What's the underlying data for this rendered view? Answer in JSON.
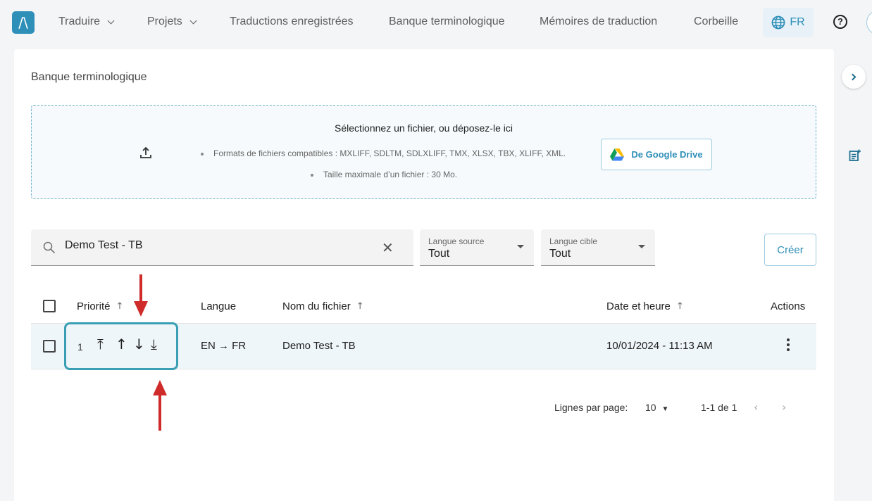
{
  "nav": {
    "logo": "/\\",
    "items": [
      "Traduire",
      "Projets",
      "Traductions enregistrées",
      "Banque terminologique",
      "Mémoires de traduction",
      "Corbeille"
    ],
    "language": "FR",
    "help": "?"
  },
  "page": {
    "title": "Banque terminologique"
  },
  "dropzone": {
    "title": "Sélectionnez un fichier, ou déposez-le ici",
    "formats": "Formats de fichiers compatibles : MXLIFF, SDLTM, SDLXLIFF, TMX, XLSX, TBX, XLIFF, XML.",
    "max_size": "Taille maximale d’un fichier : 30 Mo.",
    "gdrive_label": "De Google Drive"
  },
  "filters": {
    "search_value": "Demo Test - TB",
    "source": {
      "label": "Langue source",
      "value": "Tout"
    },
    "target": {
      "label": "Langue cible",
      "value": "Tout"
    },
    "create_label": "Créer"
  },
  "table": {
    "columns": {
      "priority": "Priorité",
      "language": "Langue",
      "filename": "Nom du fichier",
      "datetime": "Date et heure",
      "actions": "Actions"
    },
    "rows": [
      {
        "priority": "1",
        "language": "EN → FR",
        "filename": "Demo Test - TB",
        "datetime": "10/01/2024 - 11:13 AM"
      }
    ]
  },
  "pagination": {
    "rows_label": "Lignes par page:",
    "rows_value": "10",
    "range": "1-1 de 1"
  },
  "colors": {
    "accent": "#2e8fb8",
    "highlight_border": "#3a9eb5",
    "annotation": "#d02b2b"
  }
}
